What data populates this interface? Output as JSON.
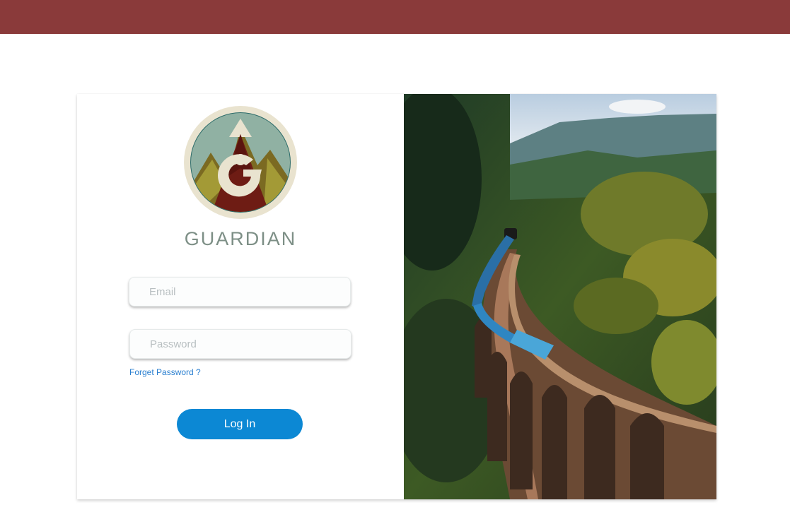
{
  "header": {
    "bar_color": "#8a3a3a"
  },
  "brand": {
    "name": "GUARDIAN",
    "logo_icon": "guardian-mountain-g-logo",
    "colors": {
      "ring": "#e9e3cf",
      "sky": "#90b1a3",
      "mountain": "#6e1c14",
      "accent": "#c7d0a5",
      "text": "#7d8f86"
    }
  },
  "login": {
    "email_placeholder": "Email",
    "password_placeholder": "Password",
    "forgot_label": "Forget Password ?",
    "submit_label": "Log In",
    "button_color": "#0c88d4",
    "link_color": "#2a7fd0"
  },
  "hero": {
    "subject": "train-on-arched-bridge-through-forest-photo"
  }
}
